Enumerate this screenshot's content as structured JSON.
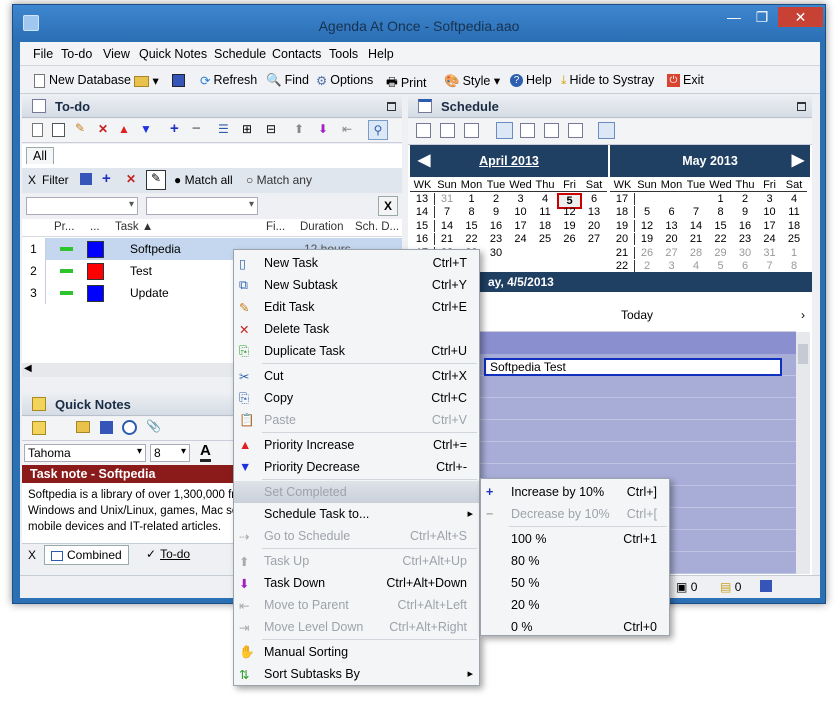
{
  "window": {
    "title": "Agenda At Once - Softpedia.aao",
    "close": "✕",
    "max": "❐",
    "min": "—"
  },
  "menubar": [
    "File",
    "To-do",
    "View",
    "Quick Notes",
    "Schedule",
    "Contacts",
    "Tools",
    "Help"
  ],
  "toolbar": {
    "new_database": "New Database",
    "refresh": "Refresh",
    "find": "Find",
    "options": "Options",
    "print": "Print",
    "style": "Style",
    "help": "Help",
    "hide": "Hide to Systray",
    "exit": "Exit"
  },
  "todo": {
    "title": "To-do",
    "tab_all": "All",
    "filter": "Filter",
    "match_all": "Match all",
    "match_any": "Match any",
    "x": "X",
    "columns": [
      "Pr...",
      "...",
      "Task ▲",
      "Fi...",
      "Duration",
      "Sch. D..."
    ],
    "rows": [
      {
        "num": "1",
        "task": "Softpedia",
        "color": "#0000ff",
        "duration": "12 hours"
      },
      {
        "num": "2",
        "task": "Test",
        "color": "#ff0000"
      },
      {
        "num": "3",
        "task": "Update",
        "color": "#0000ff"
      }
    ]
  },
  "quicknotes": {
    "title": "Quick Notes",
    "font": "Tahoma",
    "size": "8",
    "letter": "A",
    "note_title": "Task note - Softpedia",
    "note_text": "Softpedia is a library of over 1,300,000 free and free-to-try programs for Windows and Unix/Linux, games, Mac software, Windows drivers, mobile devices and IT-related articles."
  },
  "bottom_tabs": {
    "x": "X",
    "combined": "Combined",
    "todo": "To-do"
  },
  "schedule": {
    "title": "Schedule",
    "date_label": "ay, 4/5/2013",
    "today": "Today",
    "event": "Softpedia Test",
    "april": {
      "title": "April 2013",
      "head": [
        "WK",
        "Sun",
        "Mon",
        "Tue",
        "Wed",
        "Thu",
        "Fri",
        "Sat"
      ],
      "rows": [
        [
          "13",
          "31",
          "1",
          "2",
          "3",
          "4",
          "5",
          "6"
        ],
        [
          "14",
          "7",
          "8",
          "9",
          "10",
          "11",
          "12",
          "13"
        ],
        [
          "15",
          "14",
          "15",
          "16",
          "17",
          "18",
          "19",
          "20"
        ],
        [
          "16",
          "21",
          "22",
          "23",
          "24",
          "25",
          "26",
          "27"
        ],
        [
          "17",
          "28",
          "29",
          "30",
          "",
          "",
          "",
          ""
        ]
      ]
    },
    "may": {
      "title": "May 2013",
      "head": [
        "WK",
        "Sun",
        "Mon",
        "Tue",
        "Wed",
        "Thu",
        "Fri",
        "Sat"
      ],
      "rows": [
        [
          "17",
          "",
          "",
          "",
          "1",
          "2",
          "3",
          "4"
        ],
        [
          "18",
          "5",
          "6",
          "7",
          "8",
          "9",
          "10",
          "11"
        ],
        [
          "19",
          "12",
          "13",
          "14",
          "15",
          "16",
          "17",
          "18"
        ],
        [
          "20",
          "19",
          "20",
          "21",
          "22",
          "23",
          "24",
          "25"
        ],
        [
          "21",
          "26",
          "27",
          "28",
          "29",
          "30",
          "31",
          "1"
        ],
        [
          "22",
          "2",
          "3",
          "4",
          "5",
          "6",
          "7",
          "8"
        ]
      ]
    }
  },
  "context_menu": [
    {
      "label": "New Task",
      "sc": "Ctrl+T"
    },
    {
      "label": "New Subtask",
      "sc": "Ctrl+Y"
    },
    {
      "label": "Edit Task",
      "sc": "Ctrl+E"
    },
    {
      "label": "Delete Task",
      "sc": ""
    },
    {
      "label": "Duplicate Task",
      "sc": "Ctrl+U"
    },
    {
      "label": "Cut",
      "sc": "Ctrl+X"
    },
    {
      "label": "Copy",
      "sc": "Ctrl+C"
    },
    {
      "label": "Paste",
      "sc": "Ctrl+V",
      "dis": true
    },
    {
      "label": "Priority Increase",
      "sc": "Ctrl+="
    },
    {
      "label": "Priority Decrease",
      "sc": "Ctrl+-"
    },
    {
      "label": "Set Completed",
      "sc": "",
      "dis": true
    },
    {
      "label": "Schedule Task to...",
      "sc": "",
      "arrow": true
    },
    {
      "label": "Go to Schedule",
      "sc": "Ctrl+Alt+S",
      "dis": true
    },
    {
      "label": "Task Up",
      "sc": "Ctrl+Alt+Up",
      "dis": true
    },
    {
      "label": "Task Down",
      "sc": "Ctrl+Alt+Down"
    },
    {
      "label": "Move to Parent",
      "sc": "Ctrl+Alt+Left",
      "dis": true
    },
    {
      "label": "Move Level Down",
      "sc": "Ctrl+Alt+Right",
      "dis": true
    },
    {
      "label": "Manual Sorting",
      "sc": ""
    },
    {
      "label": "Sort Subtasks By",
      "sc": "",
      "arrow": true
    }
  ],
  "submenu": [
    {
      "label": "Increase by 10%",
      "sc": "Ctrl+]"
    },
    {
      "label": "Decrease by 10%",
      "sc": "Ctrl+[",
      "dis": true
    },
    {
      "label": "100 %",
      "sc": "Ctrl+1"
    },
    {
      "label": "80 %",
      "sc": ""
    },
    {
      "label": "50 %",
      "sc": ""
    },
    {
      "label": "20 %",
      "sc": ""
    },
    {
      "label": "0 %",
      "sc": "Ctrl+0"
    }
  ],
  "status": {
    "count1": "0",
    "count2": "0"
  }
}
